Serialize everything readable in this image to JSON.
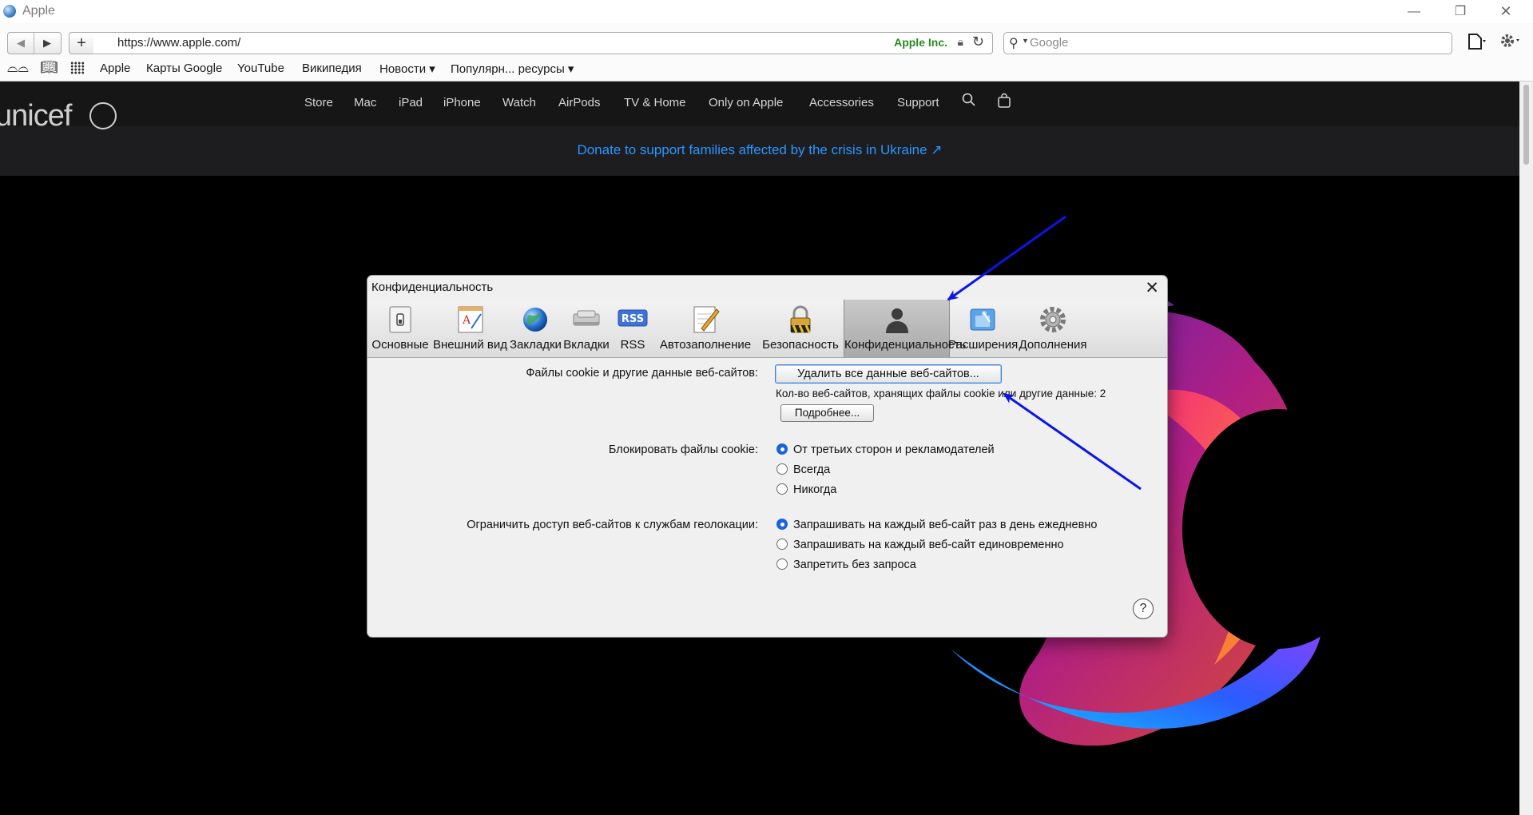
{
  "window": {
    "title": "Apple",
    "controls": {
      "minimize": "—",
      "maximize": "❐",
      "close": "✕"
    }
  },
  "toolbar": {
    "back_icon": "◀",
    "forward_icon": "▶",
    "add_icon": "+",
    "url": "https://www.apple.com/",
    "site_identity": "Apple Inc.",
    "search_placeholder": "Google"
  },
  "bookmarks": [
    "Apple",
    "Карты Google",
    "YouTube",
    "Википедия",
    "Новости ▾",
    "Популярн... ресурсы ▾"
  ],
  "apple_page": {
    "nav": [
      "Store",
      "Mac",
      "iPad",
      "iPhone",
      "Watch",
      "AirPods",
      "TV & Home",
      "Only on Apple",
      "Accessories",
      "Support"
    ],
    "banner_partner": "unicef",
    "ribbon": "Donate to support families affected by the crisis in Ukraine ↗",
    "page_background": "#000000",
    "ribbon_link_color": "#2997ff"
  },
  "dialog": {
    "title": "Конфиденциальность",
    "close_icon": "✕",
    "tabs": [
      {
        "label": "Основные",
        "icon": "switch-icon"
      },
      {
        "label": "Внешний вид",
        "icon": "appearance-icon"
      },
      {
        "label": "Закладки",
        "icon": "globe-icon"
      },
      {
        "label": "Вкладки",
        "icon": "tabs-icon"
      },
      {
        "label": "RSS",
        "icon": "rss-icon"
      },
      {
        "label": "Автозаполнение",
        "icon": "pencil-icon"
      },
      {
        "label": "Безопасность",
        "icon": "lock-icon"
      },
      {
        "label": "Конфиденциальность",
        "icon": "person-icon",
        "selected": true
      },
      {
        "label": "Расширения",
        "icon": "puzzle-icon"
      },
      {
        "label": "Дополнения",
        "icon": "gear-icon"
      }
    ],
    "rss_badge": "RSS",
    "cookies": {
      "label": "Файлы cookie и другие данные веб-сайтов:",
      "remove_button": "Удалить все данные веб-сайтов...",
      "count_text": "Кол-во веб-сайтов, хранящих файлы cookie или другие данные: 2",
      "details_button": "Подробнее..."
    },
    "block_cookies": {
      "label": "Блокировать файлы cookie:",
      "options": [
        "От третьих сторон и рекламодателей",
        "Всегда",
        "Никогда"
      ],
      "selected": 0
    },
    "geolocation": {
      "label": "Ограничить доступ веб-сайтов к службам геолокации:",
      "options": [
        "Запрашивать на каждый веб-сайт раз в день ежедневно",
        "Запрашивать на каждый веб-сайт единовременно",
        "Запретить без запроса"
      ],
      "selected": 0
    },
    "help": "?"
  },
  "annotations": {
    "arrow_color": "#0a16e6"
  }
}
